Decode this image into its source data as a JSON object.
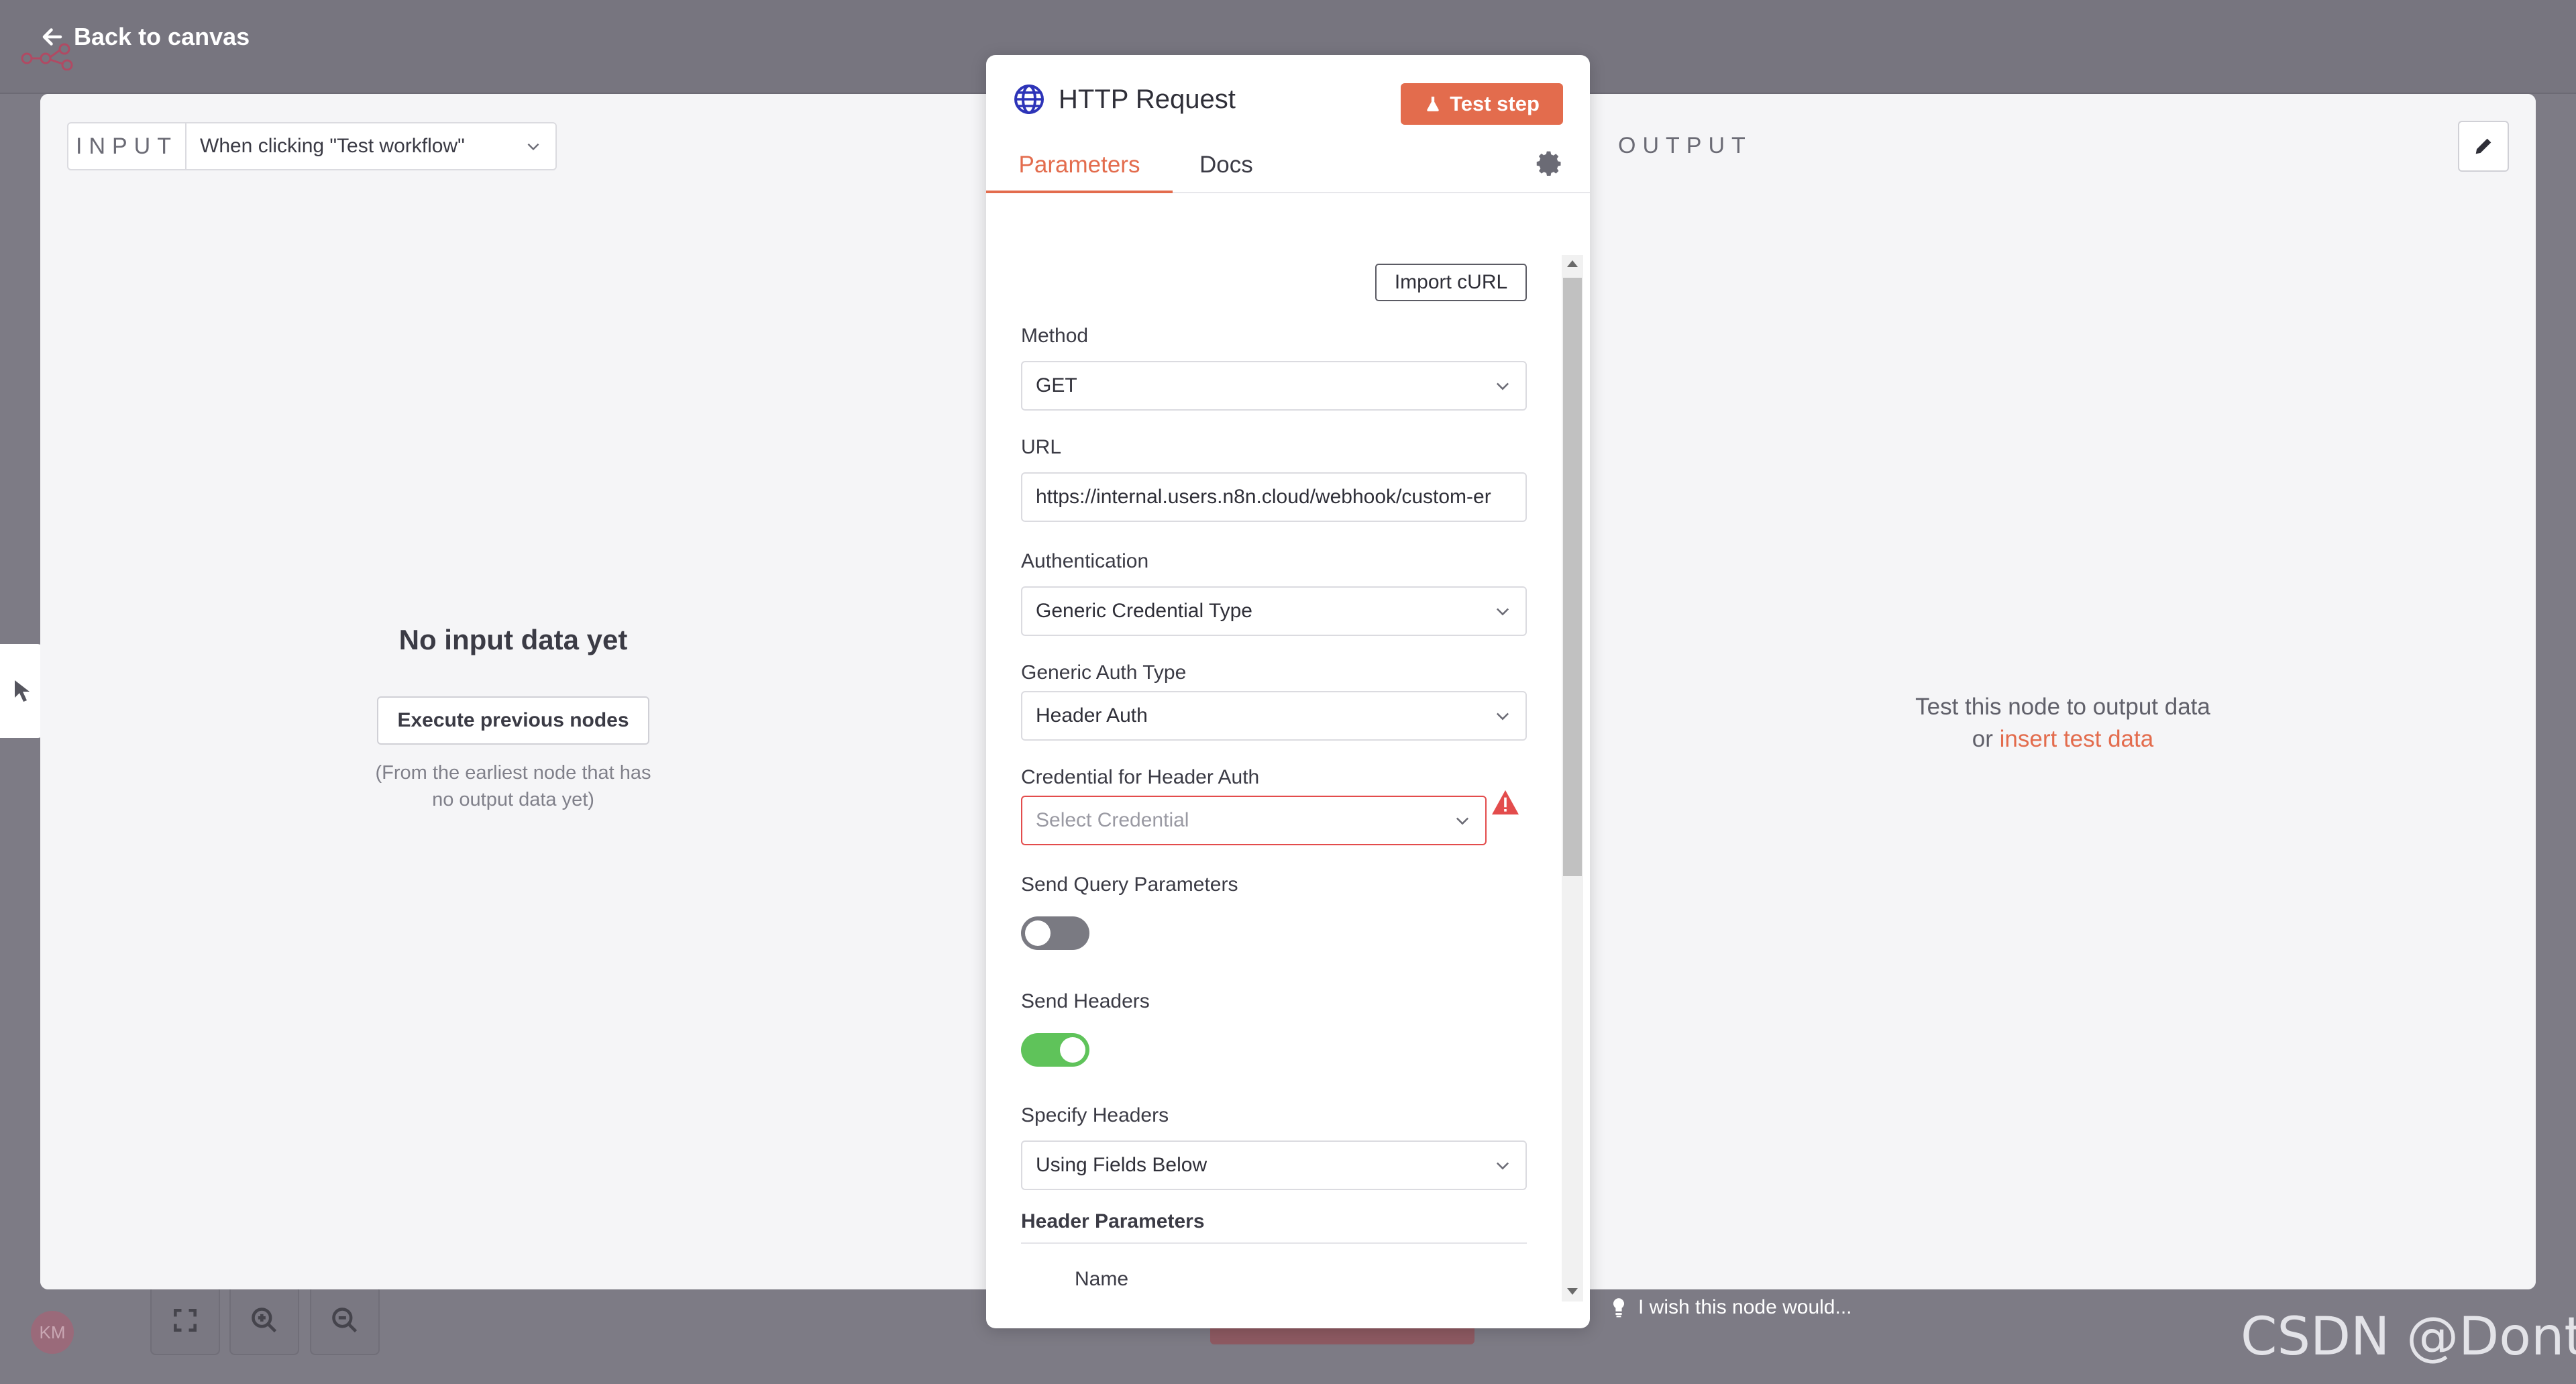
{
  "header": {
    "back_label": "Back to canvas"
  },
  "input_panel": {
    "label": "INPUT",
    "trigger_select": "When clicking \"Test workflow\"",
    "empty_title": "No input data yet",
    "execute_button": "Execute previous nodes",
    "hint": "(From the earliest node that has no output data yet)"
  },
  "output_panel": {
    "label": "OUTPUT",
    "hint_line1": "Test this node to output data",
    "hint_or": "or",
    "insert_link": "insert test data"
  },
  "node": {
    "title": "HTTP Request",
    "test_button": "Test step",
    "tabs": [
      {
        "label": "Parameters",
        "active": true
      },
      {
        "label": "Docs",
        "active": false
      }
    ],
    "import_button": "Import cURL",
    "fields": {
      "method_label": "Method",
      "method_value": "GET",
      "url_label": "URL",
      "url_value": "https://internal.users.n8n.cloud/webhook/custom-er",
      "auth_label": "Authentication",
      "auth_value": "Generic Credential Type",
      "generic_auth_label": "Generic Auth Type",
      "generic_auth_value": "Header Auth",
      "credential_label": "Credential for Header Auth",
      "credential_placeholder": "Select Credential",
      "send_query_label": "Send Query Parameters",
      "send_query_on": false,
      "send_headers_label": "Send Headers",
      "send_headers_on": true,
      "specify_headers_label": "Specify Headers",
      "specify_headers_value": "Using Fields Below",
      "header_params_label": "Header Parameters",
      "name_label": "Name"
    }
  },
  "footer": {
    "feedback": "I wish this node would...",
    "avatar_initials": "KM"
  },
  "watermark": "CSDN @Dontla",
  "colors": {
    "accent": "#e36c4d",
    "toggle_on": "#5fc35a",
    "error": "#e34c4c",
    "overlay": "#7d7b85"
  }
}
